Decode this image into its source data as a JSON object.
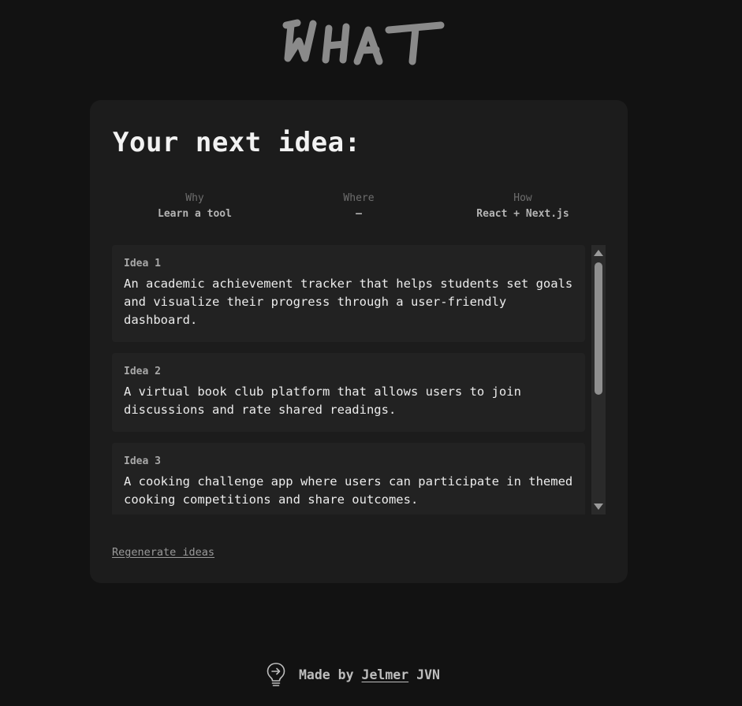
{
  "brand": {
    "logo_text": "WHAT"
  },
  "card": {
    "title": "Your next idea:",
    "params": [
      {
        "label": "Why",
        "value": "Learn a tool"
      },
      {
        "label": "Where",
        "value": "—"
      },
      {
        "label": "How",
        "value": "React + Next.js"
      }
    ],
    "ideas": [
      {
        "label": "Idea 1",
        "text": "An academic achievement tracker that helps students set goals and visualize their progress through a user-friendly dashboard."
      },
      {
        "label": "Idea 2",
        "text": "A virtual book club platform that allows users to join discussions and rate shared readings."
      },
      {
        "label": "Idea 3",
        "text": "A cooking challenge app where users can participate in themed cooking competitions and share outcomes."
      }
    ],
    "regenerate_label": "Regenerate ideas"
  },
  "footer": {
    "made_by": "Made by",
    "author_link": "Jelmer",
    "author_suffix": "JVN",
    "icon": "lightbulb-icon"
  },
  "colors": {
    "background": "#121212",
    "card": "#1c1c1c",
    "idea_card": "#222222",
    "logo": "#8a8a8a"
  }
}
